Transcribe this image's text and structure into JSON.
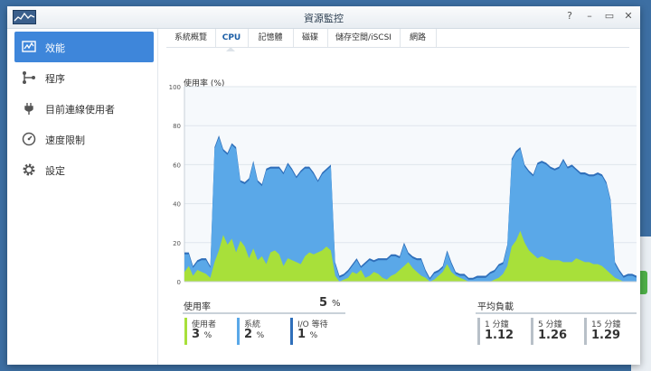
{
  "window": {
    "title": "資源監控",
    "controls": [
      "?",
      "–",
      "▭",
      "✕"
    ]
  },
  "sidebar": {
    "items": [
      {
        "label": "效能",
        "icon": "performance-icon",
        "active": true
      },
      {
        "label": "程序",
        "icon": "process-icon",
        "active": false
      },
      {
        "label": "目前連線使用者",
        "icon": "plug-icon",
        "active": false
      },
      {
        "label": "速度限制",
        "icon": "speed-limit-icon",
        "active": false
      },
      {
        "label": "設定",
        "icon": "gear-icon",
        "active": false
      }
    ]
  },
  "tabs": [
    {
      "label": "系統概覽"
    },
    {
      "label": "CPU",
      "active": true
    },
    {
      "label": "記憶體"
    },
    {
      "label": "磁碟"
    },
    {
      "label": "儲存空間/iSCSI"
    },
    {
      "label": "網路"
    }
  ],
  "chart_title": "使用率 (%)",
  "chart_data": {
    "type": "area",
    "ylabel": "使用率 (%)",
    "ylim": [
      0,
      100
    ],
    "yticks": [
      "0",
      "20",
      "40",
      "60",
      "80",
      "100"
    ],
    "grid": true,
    "series": [
      {
        "name": "使用者",
        "color": "#a8e03a",
        "values": [
          5,
          8,
          3,
          6,
          5,
          4,
          2,
          10,
          16,
          24,
          19,
          22,
          15,
          21,
          18,
          12,
          17,
          11,
          13,
          9,
          15,
          16,
          14,
          8,
          12,
          11,
          10,
          9,
          13,
          15,
          14,
          15,
          16,
          18,
          16,
          3,
          0,
          1,
          2,
          5,
          4,
          6,
          2,
          3,
          5,
          4,
          2,
          1,
          3,
          4,
          6,
          8,
          10,
          7,
          5,
          3,
          2,
          0,
          1,
          3,
          5,
          9,
          5,
          3,
          2,
          1,
          0,
          0,
          0,
          0,
          0,
          0,
          1,
          2,
          4,
          8,
          18,
          21,
          26,
          20,
          16,
          14,
          12,
          13,
          12,
          11,
          11,
          11,
          10,
          10,
          10,
          12,
          11,
          10,
          10,
          9,
          9,
          8,
          6,
          4,
          2,
          1,
          0,
          0,
          0,
          0
        ]
      },
      {
        "name": "系統",
        "color": "#5aa8e8",
        "values": [
          9,
          6,
          4,
          4,
          6,
          7,
          5,
          58,
          58,
          43,
          46,
          48,
          53,
          30,
          32,
          40,
          44,
          40,
          36,
          48,
          43,
          42,
          44,
          47,
          48,
          46,
          43,
          47,
          45,
          43,
          41,
          36,
          39,
          39,
          43,
          6,
          2,
          2,
          3,
          3,
          7,
          1,
          7,
          8,
          5,
          7,
          9,
          10,
          10,
          9,
          6,
          11,
          4,
          5,
          6,
          8,
          3,
          1,
          3,
          2,
          2,
          6,
          4,
          1,
          1,
          2,
          1,
          1,
          2,
          2,
          2,
          4,
          4,
          6,
          5,
          10,
          44,
          45,
          42,
          39,
          40,
          40,
          48,
          48,
          48,
          47,
          46,
          47,
          52,
          48,
          49,
          45,
          44,
          45,
          44,
          45,
          46,
          46,
          44,
          37,
          7,
          4,
          2,
          3,
          3,
          2
        ]
      },
      {
        "name": "I/O 等待",
        "color": "#2f6fba",
        "values": [
          1,
          1,
          1,
          1,
          1,
          1,
          1,
          1,
          1,
          1,
          1,
          1,
          1,
          1,
          1,
          1,
          1,
          1,
          1,
          1,
          1,
          1,
          1,
          1,
          1,
          1,
          1,
          1,
          1,
          1,
          1,
          1,
          1,
          1,
          1,
          1,
          1,
          1,
          1,
          1,
          1,
          1,
          1,
          1,
          1,
          1,
          1,
          1,
          1,
          1,
          1,
          1,
          1,
          1,
          1,
          1,
          1,
          1,
          1,
          1,
          1,
          1,
          1,
          1,
          1,
          1,
          1,
          1,
          1,
          1,
          1,
          1,
          1,
          1,
          1,
          1,
          1,
          1,
          1,
          1,
          1,
          1,
          1,
          1,
          1,
          1,
          1,
          1,
          1,
          1,
          1,
          1,
          1,
          1,
          1,
          1,
          1,
          1,
          1,
          1,
          1,
          1,
          1,
          1,
          1,
          1
        ]
      }
    ]
  },
  "usage": {
    "title": "使用率",
    "total": "5",
    "unit": "%",
    "items": [
      {
        "label": "使用者",
        "value": "3",
        "unit": "%",
        "color": "#a8e03a"
      },
      {
        "label": "系統",
        "value": "2",
        "unit": "%",
        "color": "#5aa8e8"
      },
      {
        "label": "I/O 等待",
        "value": "1",
        "unit": "%",
        "color": "#2f6fba"
      }
    ]
  },
  "load": {
    "title": "平均負載",
    "items": [
      {
        "label": "1 分鐘",
        "value": "1.12"
      },
      {
        "label": "5 分鐘",
        "value": "1.26"
      },
      {
        "label": "15 分鐘",
        "value": "1.29"
      }
    ]
  }
}
